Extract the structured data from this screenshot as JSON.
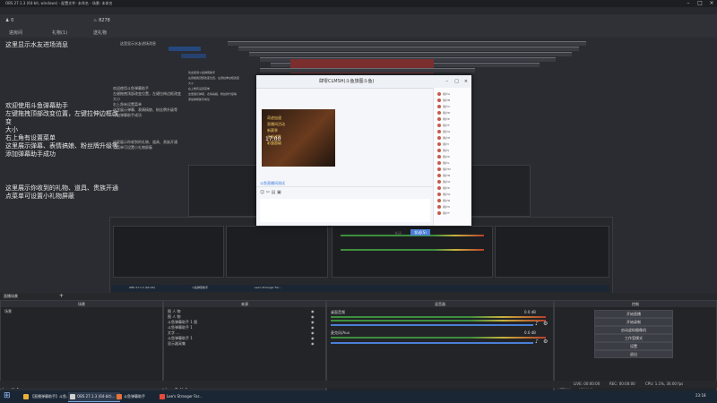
{
  "title_bar": {
    "app_title": "OBS 27.1.3 (64-bit, windows) - 配置文件: 未命名 - 场景: 未命名"
  },
  "top_stats": {
    "viewers": "0",
    "heat": "8278"
  },
  "top_tabs": [
    "进房间",
    "礼物(1)",
    "送礼物"
  ],
  "left_messages": {
    "line1": "这里显示水友进场消息",
    "line2": "欢迎使用斗鱼弹幕助手\n左键拖拽顶部改变位置，左键拉伸边框改变\n大小\n右上角有设置菜单\n这里展示弹幕、表情搞娘、粉丝牌升级等\n添加弹幕助手成功",
    "line3": "这里展示你收到的礼物、道具、贵族开通\n点菜单可设置小礼物屏蔽"
  },
  "mid_panels": {
    "panel1_title": "这里显示水友进场消息",
    "panel2_text": "欢迎使用斗鱼弹幕助手\n左键拖拽顶部改变位置，左键拉伸边框改变\n大小\n右上角有设置菜单\n这里展示弹幕、表情搞娘、粉丝牌升级等\n添加弹幕助手成功",
    "panel3_text": "这里展示你收到的礼物、道具、贵族开通\n点菜单可设置小礼物屏蔽"
  },
  "chat_dialog": {
    "title": "肆零CLMSH(斗鱼旅图斗鱼)",
    "poster_lines": [
      "奇迹加速",
      "直播间活动",
      "新赛季",
      "全新皮肤",
      "彩蛋超级"
    ],
    "poster_time": "17:00",
    "message_link": "斗鱼直播间测试",
    "user_list": [
      "用户A",
      "用户B",
      "用户C",
      "用户D",
      "用户E",
      "用户F",
      "用户G",
      "用户H",
      "用户I",
      "用户J",
      "用户K",
      "用户L",
      "用户M",
      "用户N",
      "用户O",
      "用户P",
      "用户Q",
      "用户R",
      "用户S",
      "用户T"
    ],
    "send_label": "发送(S)",
    "close_label": "关闭"
  },
  "obs_nested_taskbar": {
    "item1": "OBS 27.1.3 (64-bit)",
    "item2": "斗鱼弹幕助手",
    "item3": "Lee's Stranger Far..."
  },
  "docks": {
    "scenes": {
      "title": "场景",
      "items": [
        "场景"
      ]
    },
    "sources": {
      "title": "来源",
      "items": [
        "图 人 物",
        "图 人 物",
        "斗鱼弹幕助手 1 图",
        "斗鱼弹幕助手 1",
        "文字 ...",
        "斗鱼弹幕助手 1",
        "显示器采集"
      ]
    },
    "mixer": {
      "title": "混音器",
      "track1_name": "桌面音频",
      "track1_db": "0.0 dB",
      "track2_name": "麦克风/Aux",
      "track2_db": "0.0 dB"
    },
    "controls": {
      "title": "控制",
      "buttons": [
        "开始直播",
        "开始录制",
        "启动虚拟摄像机",
        "工作室模式",
        "设置",
        "退出"
      ]
    },
    "transitions_tab": "场景转场",
    "controls_tab": "控件"
  },
  "top_tabs_row": {
    "scene_tab": "直播场景",
    "add_tab": "+"
  },
  "status_bar": {
    "live": "LIVE: 00:00:00",
    "rec": "REC: 00:00:00",
    "cpu": "CPU: 1.1%, 30.00 fps"
  },
  "taskbar": {
    "items": [
      "【直播弹幕助手】斗鱼...",
      "OBS 27.1.3 (64-bit)...",
      "斗鱼弹幕助手",
      "Lee's Stranger Far..."
    ],
    "clock": "23:18"
  },
  "colors": {
    "accent_blue": "#26477d",
    "background": "#2a2c31",
    "taskbar": "#1b2634"
  }
}
